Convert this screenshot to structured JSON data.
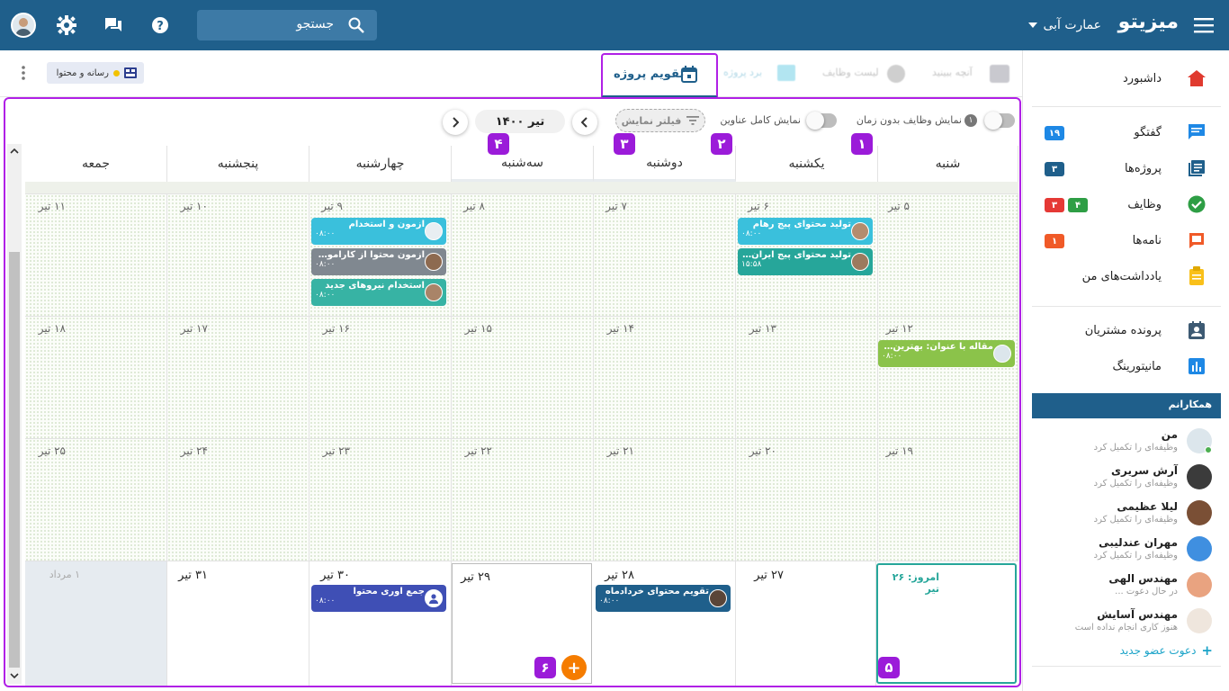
{
  "topbar": {
    "brand": "میزیتو",
    "building": "عمارت آبی",
    "search_placeholder": "جستجو"
  },
  "tabs": {
    "calendar_label": "تقویم پروژه",
    "tab_list_label": "لیست وظایف",
    "tab_board_label": "برد پروژه",
    "tab_flow_label": "آنچه ببینید",
    "project_chip_label": "رسانه و محتوا"
  },
  "toolbar": {
    "toggle_no_time_label": "نمایش وظایف بدون زمان",
    "toggle_no_time_count": "۱",
    "toggle_full_titles_label": "نمایش کامل عناوین",
    "filter_label": "فیلتر نمایش",
    "month_label": "تیر ۱۴۰۰"
  },
  "markers": [
    "۱",
    "۲",
    "۳",
    "۴",
    "۵",
    "۶"
  ],
  "weekdays": [
    "شنبه",
    "یکشنبه",
    "دوشنبه",
    "سه‌شنبه",
    "چهارشنبه",
    "پنجشنبه",
    "جمعه"
  ],
  "weeks": [
    [
      "۵ تیر",
      "۶ تیر",
      "۷ تیر",
      "۸ تیر",
      "۹ تیر",
      "۱۰ تیر",
      "۱۱ تیر"
    ],
    [
      "۱۲ تیر",
      "۱۳ تیر",
      "۱۴ تیر",
      "۱۵ تیر",
      "۱۶ تیر",
      "۱۷ تیر",
      "۱۸ تیر"
    ],
    [
      "۱۹ تیر",
      "۲۰ تیر",
      "۲۱ تیر",
      "۲۲ تیر",
      "۲۳ تیر",
      "۲۴ تیر",
      "۲۵ تیر"
    ],
    [
      "امروز: ۲۶ تیر",
      "۲۷ تیر",
      "۲۸ تیر",
      "۲۹ تیر",
      "۳۰ تیر",
      "۳۱ تیر",
      "۱ مرداد"
    ]
  ],
  "events": {
    "e1": {
      "title": "تولید محتوای پیج رهام",
      "time": "۰۸:۰۰",
      "color": "#3ac0dc"
    },
    "e2": {
      "title": "تولید محتوای پیج ایران بی...",
      "time": "۱۵:۵۸",
      "color": "#26a69a"
    },
    "e3": {
      "title": "آزمون و استخدام",
      "time": "۰۸:۰۰",
      "color": "#3ac0dc"
    },
    "e4": {
      "title": "آزمون محتوا از کارآموزان ج...",
      "time": "۰۸:۰۰",
      "color": "#808890"
    },
    "e5": {
      "title": "استخدام نیروهای جدید",
      "time": "۰۸:۰۰",
      "color": "#37b3a4"
    },
    "e6": {
      "title": "مقاله با عنوان: بهترین را...",
      "time": "۰۸:۰۰",
      "color": "#8bc34a"
    },
    "e7": {
      "title": "تقویم محتوای خردادماه",
      "time": "۰۸:۰۰",
      "color": "#1f5f8b"
    },
    "e8": {
      "title": "جمع آوری محتوا",
      "time": "۰۸:۰۰",
      "color": "#3f4fb5"
    }
  },
  "add_button": "+",
  "sidebar": {
    "dashboard": "داشبورد",
    "chat": "گفتگو",
    "chat_badge": "۱۹",
    "projects": "پروژه‌ها",
    "projects_badge": "۳",
    "tasks": "وظایف",
    "tasks_badge_green": "۴",
    "tasks_badge_red": "۳",
    "letters": "نامه‌ها",
    "letters_badge": "۱",
    "notes": "یادداشت‌های من",
    "customers": "پرونده مشتریان",
    "monitoring": "مانیتورینگ",
    "colleagues_title": "همکارانم",
    "colleagues": [
      {
        "name": "من",
        "status": "وظیفه‌ای را تکمیل کرد"
      },
      {
        "name": "آرش سریری",
        "status": "وظیفه‌ای را تکمیل کرد"
      },
      {
        "name": "لیلا عظیمی",
        "status": "وظیفه‌ای را تکمیل کرد"
      },
      {
        "name": "مهران عندلیبی",
        "status": "وظیفه‌ای را تکمیل کرد"
      },
      {
        "name": "مهندس الهی",
        "status": "در حال دعوت ..."
      },
      {
        "name": "مهندس آسایش",
        "status": "هنوز کاری انجام نداده است"
      }
    ],
    "invite": "دعوت عضو جدید"
  },
  "colors": {
    "topbar": "#1f5f8b",
    "accent": "#b020e6",
    "marker": "#9b1bd9",
    "today_border": "#26a69a",
    "add_button": "#f57c00"
  }
}
